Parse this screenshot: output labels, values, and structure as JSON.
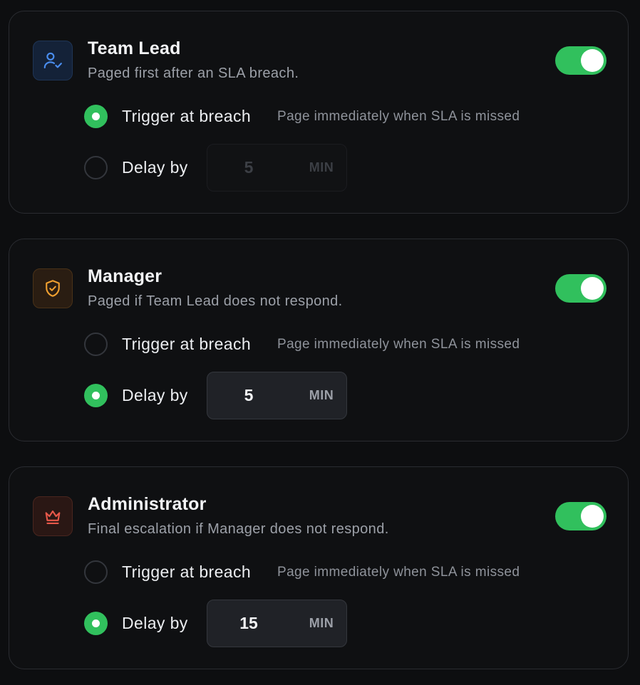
{
  "colors": {
    "accent_green": "#31c05d",
    "team_lead_icon": "#4a8ef0",
    "manager_icon": "#f0a030",
    "administrator_icon": "#e8584a"
  },
  "levels": [
    {
      "title": "Team Lead",
      "description": "Paged first after an SLA breach.",
      "icon": "user-check-icon",
      "enabled": true,
      "trigger_label": "Trigger at breach",
      "trigger_hint": "Page immediately when SLA is missed",
      "delay_label": "Delay by",
      "selected": "trigger",
      "delay_value": "5",
      "delay_unit": "MIN"
    },
    {
      "title": "Manager",
      "description": "Paged if Team Lead does not respond.",
      "icon": "shield-check-icon",
      "enabled": true,
      "trigger_label": "Trigger at breach",
      "trigger_hint": "Page immediately when SLA is missed",
      "delay_label": "Delay by",
      "selected": "delay",
      "delay_value": "5",
      "delay_unit": "MIN"
    },
    {
      "title": "Administrator",
      "description": "Final escalation if Manager does not respond.",
      "icon": "crown-icon",
      "enabled": true,
      "trigger_label": "Trigger at breach",
      "trigger_hint": "Page immediately when SLA is missed",
      "delay_label": "Delay by",
      "selected": "delay",
      "delay_value": "15",
      "delay_unit": "MIN"
    }
  ]
}
